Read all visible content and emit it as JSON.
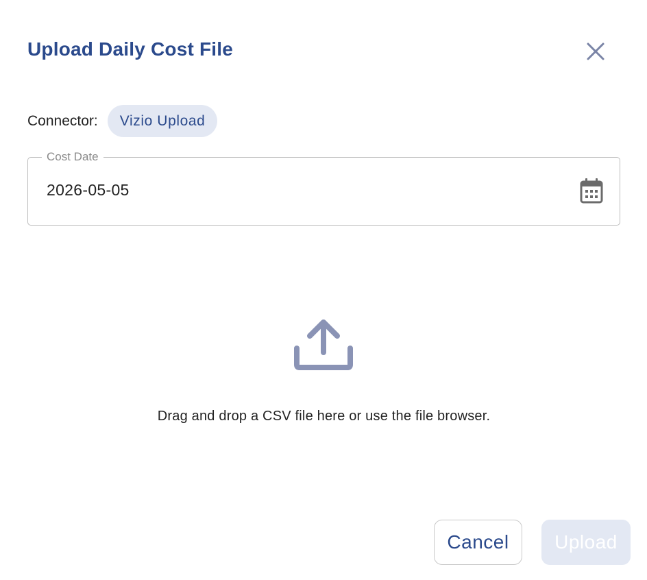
{
  "dialog": {
    "title": "Upload Daily Cost File",
    "close_icon": "close-icon"
  },
  "connector": {
    "label": "Connector:",
    "value": "Vizio Upload"
  },
  "cost_date": {
    "label": "Cost Date",
    "value": "2026-05-05",
    "icon": "calendar-icon"
  },
  "dropzone": {
    "icon": "upload-icon",
    "text": "Drag and drop a CSV file here or use the file browser."
  },
  "actions": {
    "cancel_label": "Cancel",
    "upload_label": "Upload",
    "upload_disabled": true
  },
  "colors": {
    "primary": "#2b4a8c",
    "chip_bg": "#e3e8f3",
    "icon_gray": "#8a93b5"
  }
}
